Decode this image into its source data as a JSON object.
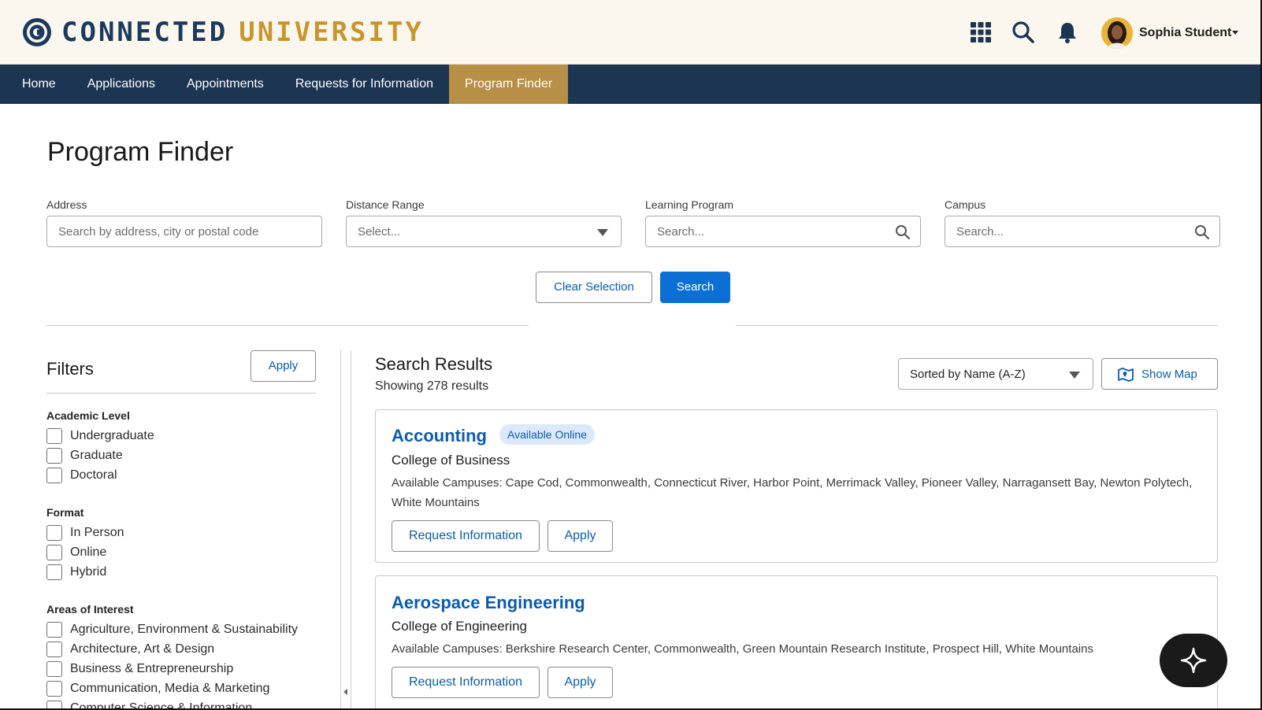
{
  "header": {
    "logo_word1": "CONNECTED",
    "logo_word2": "UNIVERSITY",
    "user_name": "Sophia Student",
    "icons": [
      "grid-icon",
      "search-icon",
      "bell-icon",
      "avatar"
    ]
  },
  "nav": {
    "items": [
      {
        "label": "Home"
      },
      {
        "label": "Applications"
      },
      {
        "label": "Appointments"
      },
      {
        "label": "Requests for Information"
      },
      {
        "label": "Program Finder",
        "active": true
      }
    ]
  },
  "page": {
    "title": "Program Finder"
  },
  "search": {
    "address_label": "Address",
    "address_placeholder": "Search by address, city or postal code",
    "distance_label": "Distance Range",
    "distance_placeholder": "Select...",
    "program_label": "Learning Program",
    "program_placeholder": "Search...",
    "campus_label": "Campus",
    "campus_placeholder": "Search...",
    "clear_label": "Clear Selection",
    "search_label": "Search"
  },
  "filters": {
    "title": "Filters",
    "apply_label": "Apply",
    "groups": [
      {
        "title": "Academic Level",
        "options": [
          "Undergraduate",
          "Graduate",
          "Doctoral"
        ]
      },
      {
        "title": "Format",
        "options": [
          "In Person",
          "Online",
          "Hybrid"
        ]
      },
      {
        "title": "Areas of Interest",
        "options": [
          "Agriculture, Environment & Sustainability",
          "Architecture, Art & Design",
          "Business & Entrepreneurship",
          "Communication, Media & Marketing",
          "Computer Science & Information"
        ]
      }
    ]
  },
  "results": {
    "title": "Search Results",
    "count_text": "Showing 278 results",
    "sort_label": "Sorted by Name (A-Z)",
    "map_label": "Show Map",
    "items": [
      {
        "name": "Accounting",
        "badge": "Available Online",
        "college": "College of Business",
        "campuses": "Available Campuses: Cape Cod, Commonwealth, Connecticut River, Harbor Point, Merrimack Valley, Pioneer Valley, Narragansett Bay, Newton Polytech, White Mountains",
        "request_label": "Request Information",
        "apply_label": "Apply"
      },
      {
        "name": "Aerospace Engineering",
        "college": "College of Engineering",
        "campuses": "Available Campuses: Berkshire Research Center, Commonwealth, Green Mountain Research Institute, Prospect Hill, White Mountains",
        "request_label": "Request Information",
        "apply_label": "Apply"
      }
    ]
  },
  "colors": {
    "navy": "#1c3553",
    "gold": "#b78f46",
    "link_blue": "#0b5cad",
    "primary_blue": "#0b6fd6",
    "header_bg": "#fbf7ef"
  }
}
